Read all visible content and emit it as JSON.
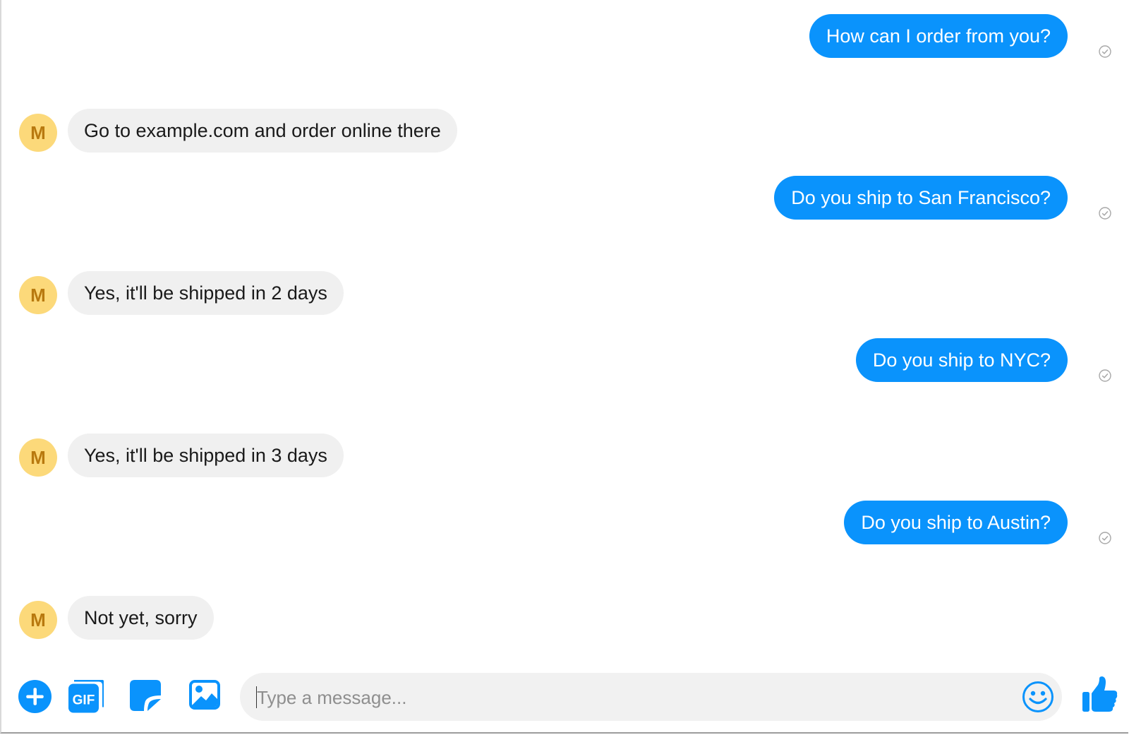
{
  "conversation": {
    "messages": [
      {
        "sender": "user",
        "text": "How can I order from you?"
      },
      {
        "sender": "bot",
        "avatar_letter": "M",
        "text": "Go to example.com and order online there"
      },
      {
        "sender": "user",
        "text": "Do you ship to San Francisco?"
      },
      {
        "sender": "bot",
        "avatar_letter": "M",
        "text": "Yes, it'll be shipped in 2 days"
      },
      {
        "sender": "user",
        "text": "Do you ship to NYC?"
      },
      {
        "sender": "bot",
        "avatar_letter": "M",
        "text": "Yes, it'll be shipped in 3 days"
      },
      {
        "sender": "user",
        "text": "Do you ship to Austin?"
      },
      {
        "sender": "bot",
        "avatar_letter": "M",
        "text": "Not yet, sorry"
      }
    ]
  },
  "composer": {
    "placeholder": "Type a message...",
    "value": "",
    "gif_label": "GIF",
    "icons": [
      "plus-icon",
      "gif-icon",
      "sticker-icon",
      "photo-icon",
      "emoji-icon",
      "thumbs-up-icon"
    ]
  },
  "colors": {
    "accent": "#0a93fc",
    "incoming_bubble": "#f0f0f0",
    "avatar_bg": "#fcd97a",
    "avatar_text": "#b8790f"
  }
}
